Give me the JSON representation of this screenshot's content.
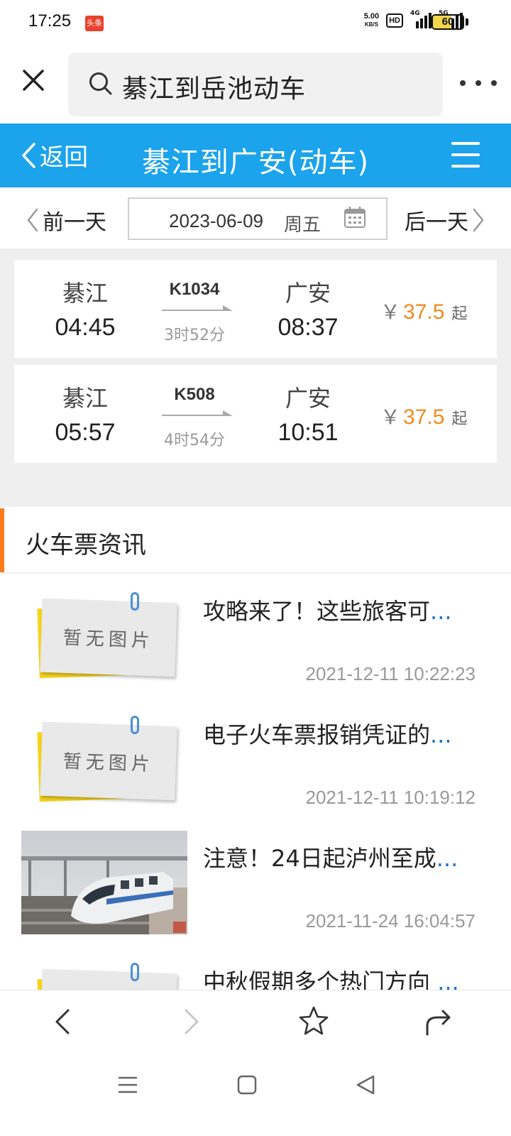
{
  "status_bar": {
    "time": "17:25",
    "app_icon_label": "头条",
    "net_speed_value": "5.00",
    "net_speed_unit": "KB/S",
    "hd_label": "HD",
    "signal_1_tag": "4G",
    "signal_2_tag": "5G",
    "battery_level": "60"
  },
  "browser": {
    "search_query": "綦江到岳池动车"
  },
  "page_header": {
    "back_label": "返回",
    "title": "綦江到广安(动车)"
  },
  "date_bar": {
    "prev_label": "前一天",
    "date": "2023-06-09",
    "weekday": "周五",
    "next_label": "后一天"
  },
  "trains": [
    {
      "from_station": "綦江",
      "depart_time": "04:45",
      "train_no": "K1034",
      "duration": "3时52分",
      "to_station": "广安",
      "arrive_time": "08:37",
      "currency": "￥",
      "price": "37.5",
      "price_suffix": "起"
    },
    {
      "from_station": "綦江",
      "depart_time": "05:57",
      "train_no": "K508",
      "duration": "4时54分",
      "to_station": "广安",
      "arrive_time": "10:51",
      "currency": "￥",
      "price": "37.5",
      "price_suffix": "起"
    }
  ],
  "news": {
    "section_title": "火车票资讯",
    "placeholder_text": "暂无图片",
    "ellipsis": "...",
    "items": [
      {
        "title": "攻略来了！这些旅客可",
        "time": "2021-12-11 10:22:23",
        "thumb": "placeholder"
      },
      {
        "title": "电子火车票报销凭证的",
        "time": "2021-12-11 10:19:12",
        "thumb": "placeholder"
      },
      {
        "title": "注意！24日起泸州至成",
        "time": "2021-11-24 16:04:57",
        "thumb": "train-photo"
      },
      {
        "title": "中秋假期多个热门方向 ",
        "time": "",
        "thumb": "placeholder"
      }
    ]
  },
  "colors": {
    "header_blue": "#1ba3ec",
    "price_orange": "#f08a1c",
    "section_accent": "#ff7a1a",
    "ellipsis_blue": "#1a73c8"
  },
  "icons": {
    "browser_close": "close-icon",
    "search": "search-icon",
    "more": "more-icon",
    "back": "chevron-left-icon",
    "menu": "hamburger-menu-icon",
    "calendar": "calendar-icon",
    "toolbar": [
      "back-arrow-icon",
      "forward-arrow-icon",
      "star-icon",
      "share-icon"
    ],
    "system_nav": [
      "recent-apps-icon",
      "home-icon",
      "back-triangle-icon"
    ]
  }
}
